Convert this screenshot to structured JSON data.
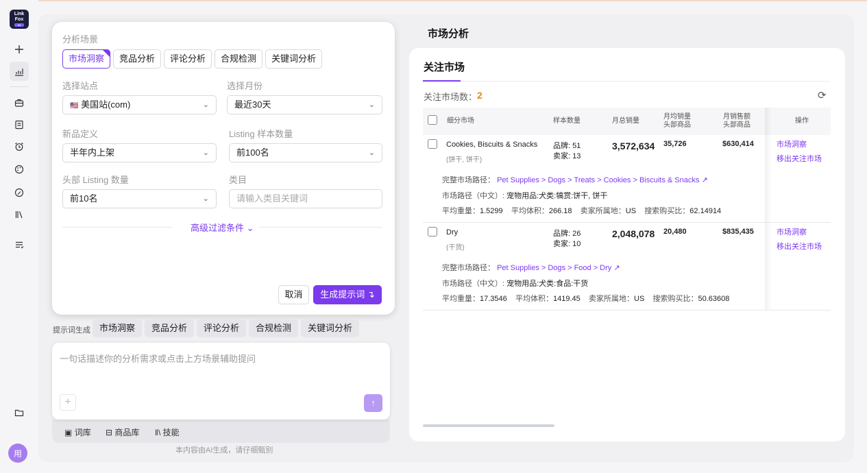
{
  "logo": {
    "line1": "Link",
    "line2": "Fox",
    "badge": "AI"
  },
  "rail": {
    "icons": [
      "plus-icon",
      "chart-icon",
      "briefcase-icon",
      "book-icon",
      "alarm-icon",
      "palette-icon",
      "pen-icon",
      "library-icon",
      "list-icon",
      "folder-icon"
    ],
    "avatar": "用"
  },
  "panel": {
    "scene_label": "分析场景",
    "scene_tabs": [
      "市场洞察",
      "竞品分析",
      "评论分析",
      "合规检测",
      "关键词分析"
    ],
    "site_label": "选择站点",
    "site_flag": "🇺🇸",
    "site_value": "美国站(com)",
    "month_label": "选择月份",
    "month_value": "最近30天",
    "new_label": "新品定义",
    "new_value": "半年内上架",
    "listing_label": "Listing 样本数量",
    "listing_value": "前100名",
    "head_label": "头部 Listing 数量",
    "head_value": "前10名",
    "category_label": "类目",
    "category_placeholder": "请输入类目关键词",
    "advanced": "高级过滤条件",
    "cancel": "取消",
    "generate": "生成提示词"
  },
  "prompt": {
    "label": "提示词生成",
    "tabs": [
      "市场洞察",
      "竞品分析",
      "评论分析",
      "合规检测",
      "关键词分析"
    ],
    "placeholder": "一句话描述你的分析需求或点击上方场景辅助提问",
    "bottom": [
      "词库",
      "商品库",
      "技能"
    ],
    "footer": "本内容由AI生成，请仔细甄别"
  },
  "right": {
    "title": "市场分析",
    "subtitle": "关注市场",
    "count_label": "关注市场数：",
    "count_value": "2",
    "headers": {
      "market": "细分市场",
      "sample": "样本数量",
      "monthly_sales": "月总销量",
      "head_sales_l1": "月均销量",
      "head_sales_l2": "头部商品",
      "head_rev_l1": "月销售额",
      "head_rev_l2": "头部商品",
      "ops": "操作"
    },
    "rows": [
      {
        "name": "Cookies, Biscuits & Snacks",
        "name_cn": "(饼干, 饼干)",
        "brands": "品牌: 51",
        "sellers": "卖家: 13",
        "total_sales": "3,572,634",
        "avg_sales": "35,726",
        "revenue": "$630,414",
        "op1": "市场洞察",
        "op2": "移出关注市场",
        "path_label": "完整市场路径：",
        "path": "Pet Supplies > Dogs > Treats > Cookies > Biscuits & Snacks",
        "path_cn_label": "市场路径（中文）:",
        "path_cn": "宠物用品:犬类:犒赏:饼干, 饼干",
        "weight_label": "平均重量：",
        "weight": "1.5299",
        "volume_label": "平均体积：",
        "volume": "266.18",
        "seller_loc_label": "卖家所属地：",
        "seller_loc": "US",
        "search_ratio_label": "搜索购买比：",
        "search_ratio": "62.14914"
      },
      {
        "name": "Dry",
        "name_cn": "(干货)",
        "brands": "品牌: 26",
        "sellers": "卖家: 10",
        "total_sales": "2,048,078",
        "avg_sales": "20,480",
        "revenue": "$835,435",
        "op1": "市场洞察",
        "op2": "移出关注市场",
        "path_label": "完整市场路径：",
        "path": "Pet Supplies > Dogs > Food > Dry",
        "path_cn_label": "市场路径（中文）:",
        "path_cn": "宠物用品:犬类:食品:干货",
        "weight_label": "平均重量：",
        "weight": "17.3546",
        "volume_label": "平均体积：",
        "volume": "1419.45",
        "seller_loc_label": "卖家所属地：",
        "seller_loc": "US",
        "search_ratio_label": "搜索购买比：",
        "search_ratio": "50.63608"
      }
    ]
  },
  "colors": {
    "accent": "#7c3aed",
    "count": "#e08a1a",
    "background": "#f5f5f7"
  }
}
